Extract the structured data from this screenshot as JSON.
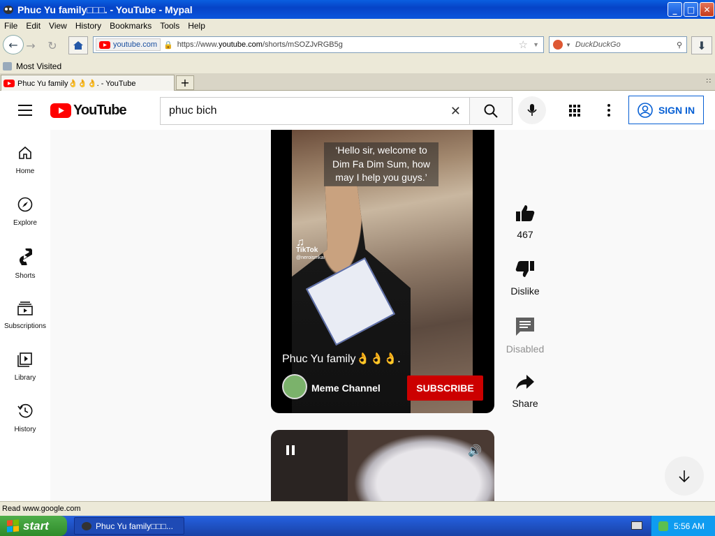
{
  "window": {
    "title": "Phuc Yu family□□□. - YouTube - Mypal",
    "minimize": "_",
    "maximize": "□",
    "close": "✕"
  },
  "menu": [
    "File",
    "Edit",
    "View",
    "History",
    "Bookmarks",
    "Tools",
    "Help"
  ],
  "nav": {
    "site_label": "youtube.com",
    "url_prefix": "https://www.",
    "url_domain": "youtube.com",
    "url_path": "/shorts/mSOZJvRGB5g",
    "search_placeholder": "DuckDuckGo"
  },
  "bookmarks": {
    "most_visited": "Most Visited"
  },
  "tabs": [
    {
      "label": "Phuc Yu family👌👌👌. - YouTube"
    }
  ],
  "youtube": {
    "logo_text": "YouTube",
    "search_value": "phuc bich",
    "sign_in": "SIGN IN",
    "sidebar": [
      {
        "label": "Home",
        "icon": "home-icon"
      },
      {
        "label": "Explore",
        "icon": "compass-icon"
      },
      {
        "label": "Shorts",
        "icon": "shorts-icon"
      },
      {
        "label": "Subscriptions",
        "icon": "subscriptions-icon"
      },
      {
        "label": "Library",
        "icon": "library-icon"
      },
      {
        "label": "History",
        "icon": "history-icon"
      }
    ],
    "short": {
      "caption": "‘Hello sir, welcome to Dim Fa Dim Sum, how may I help you guys.’",
      "tiktok_label": "TikTok",
      "tiktok_user": "@neroismkai",
      "title": "Phuc Yu family👌👌👌.",
      "channel": "Meme Channel",
      "subscribe": "SUBSCRIBE"
    },
    "actions": {
      "likes": "467",
      "dislike": "Dislike",
      "comments": "Disabled",
      "share": "Share"
    }
  },
  "status": "Read www.google.com",
  "taskbar": {
    "start": "start",
    "task": "Phuc Yu family□□□...",
    "clock": "5:56 AM"
  }
}
